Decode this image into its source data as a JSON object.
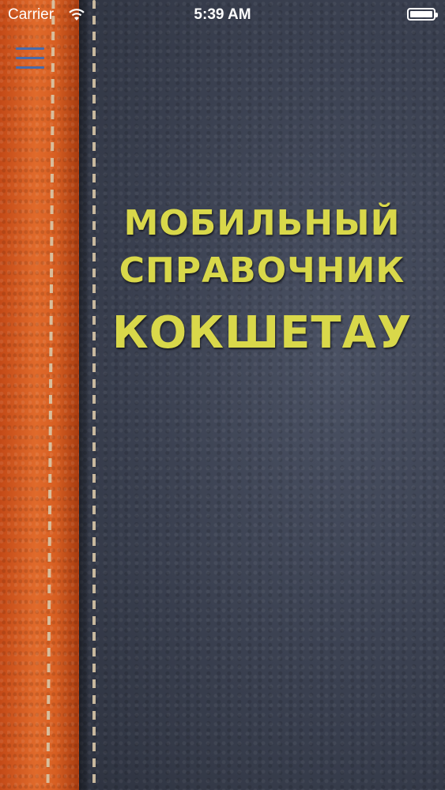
{
  "status_bar": {
    "carrier": "Carrier",
    "time": "5:39 AM",
    "icons": [
      "wifi-icon",
      "battery-icon"
    ]
  },
  "menu": {
    "icon": "hamburger-menu-icon",
    "color": "#4a6aa8"
  },
  "title": {
    "line1": "МОБИЛЬНЫЙ",
    "line2": "СПРАВОЧНИК",
    "city": "КОКШЕТАУ",
    "color": "#d9d84a"
  },
  "colors": {
    "orange_leather": "#d85f22",
    "blue_leather": "#3b4150",
    "stitch": "#d9c7a8"
  }
}
